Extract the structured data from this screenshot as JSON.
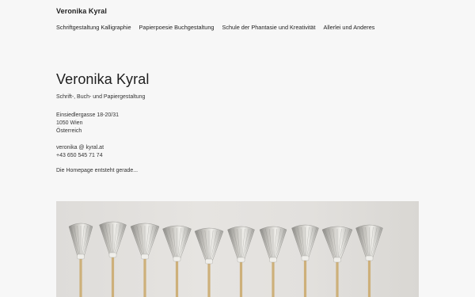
{
  "header": {
    "site_title": "Veronika Kyral",
    "nav": [
      {
        "label": "Schriftgestaltung Kalligraphie"
      },
      {
        "label": "Papierpoesie Buchgestaltung"
      },
      {
        "label": "Schule der Phantasie und Kreativität"
      },
      {
        "label": "Allerlei und Anderes"
      }
    ]
  },
  "main": {
    "title": "Veronika Kyral",
    "tagline": "Schrift-, Buch- und Papiergestaltung",
    "address": {
      "street": "Einsiedlergasse 18-20/31",
      "city": "1050 Wien",
      "country": "Österreich"
    },
    "contact": {
      "email": "veronika @ kyral.at",
      "phone": "+43 650 545 71 74"
    },
    "note": "Die Homepage entsteht gerade..."
  },
  "photo": {
    "subject": "paper-brushes-image",
    "count": 10
  }
}
